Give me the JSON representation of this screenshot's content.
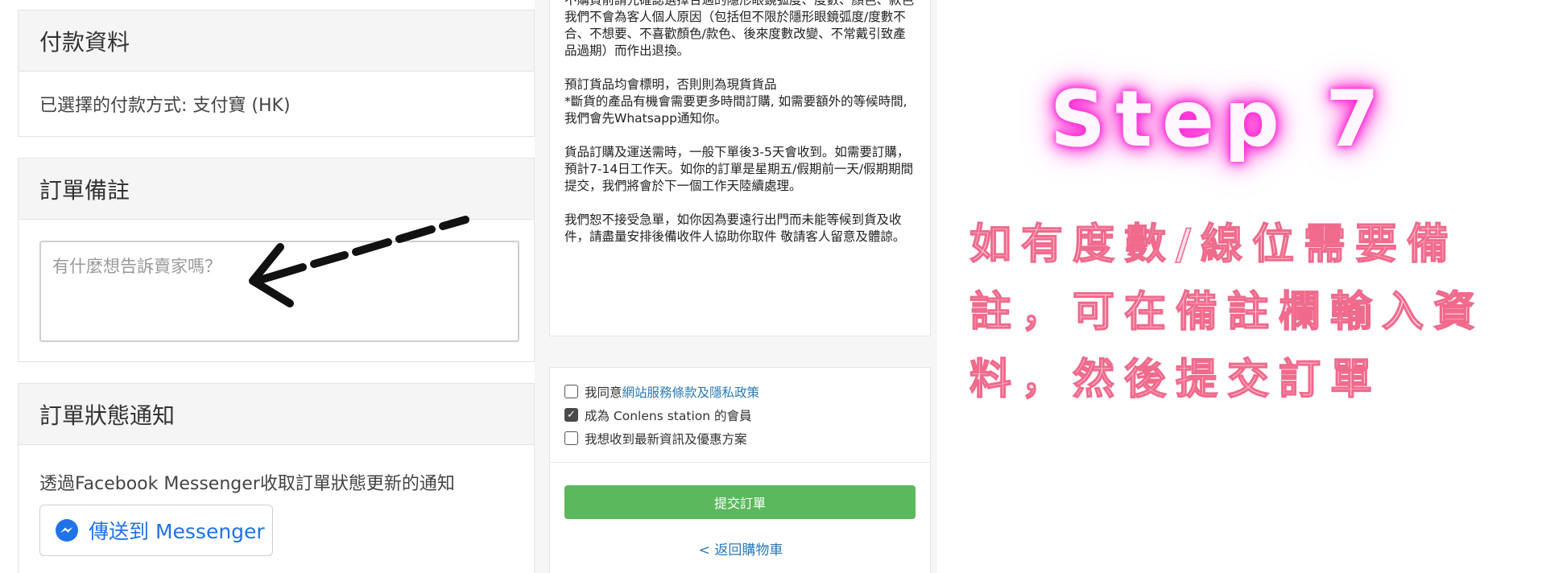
{
  "payment": {
    "title": "付款資料",
    "selected_method": "已選擇的付款方式: 支付寶 (HK)"
  },
  "remarks": {
    "title": "訂單備註",
    "placeholder": "有什麼想告訴賣家嗎？"
  },
  "status_notify": {
    "title": "訂單狀態通知",
    "description": "透過Facebook Messenger收取訂單狀態更新的通知",
    "messenger_button": "傳送到 Messenger"
  },
  "policy": {
    "paragraphs": [
      "不購買前請先確認選擇合適的隱形眼鏡弧度、度數、顏色、款色\n我們不會為客人個人原因（包括但不限於隱形眼鏡弧度/度數不合、不想要、不喜歡顏色/款色、後來度數改變、不常戴引致產品過期）而作出退換。",
      "預訂貨品均會標明，否則則為現貨貨品\n*斷貨的產品有機會需要更多時間訂購, 如需要額外的等候時間, 我們會先Whatsapp通知你。",
      "貨品訂購及運送需時，一般下單後3-5天會收到。如需要訂購，預計7-14日工作天。如你的訂單是星期五/假期前一天/假期期間提交，我們將會於下一個工作天陸續處理。",
      "我們恕不接受急單，如你因為要遠行出門而未能等候到貨及收件，請盡量安排後備收件人協助你取件 敬請客人留意及體諒。"
    ]
  },
  "agreements": {
    "terms_prefix": "我同意",
    "terms_link": "網站服務條款及隱私政策",
    "member_label": "成為 Conlens station 的會員",
    "newsletter_label": "我想收到最新資訊及優惠方案",
    "member_checked": true
  },
  "actions": {
    "submit": "提交訂單",
    "back": "< 返回購物車"
  },
  "instruction": {
    "step": "Step 7",
    "text": "如有度數/線位需要備註，可在備註欄輸入資料，然後提交訂單"
  },
  "colors": {
    "submit_green": "#5cb85c",
    "link_blue": "#2a7ab8",
    "messenger_blue": "#1e73e8",
    "neon_pink": "#ff2bd6",
    "desc_pink": "#f06a8c"
  }
}
